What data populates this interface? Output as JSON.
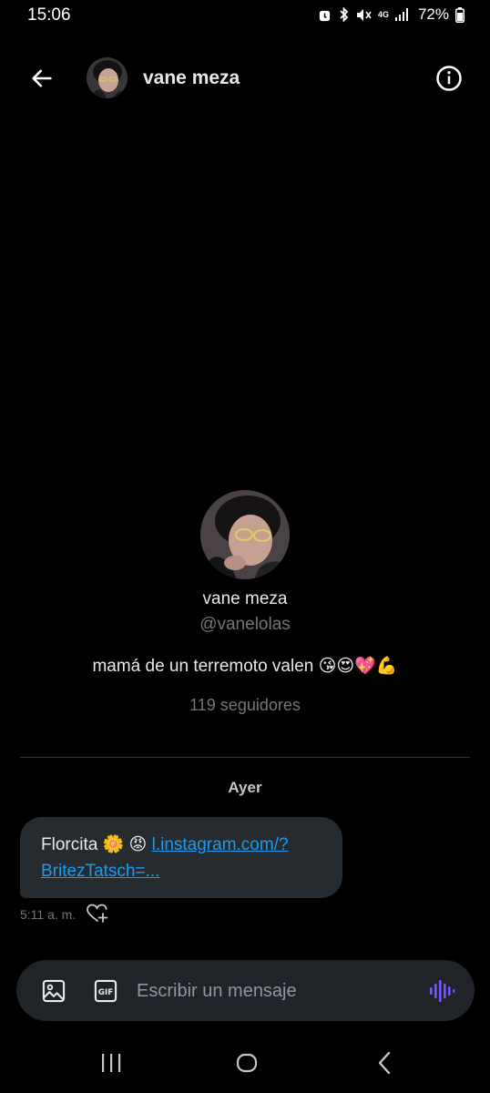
{
  "status_bar": {
    "time": "15:06",
    "battery_percent": "72%",
    "network_label": "4G",
    "icons": [
      "alarm-icon",
      "bluetooth-icon",
      "mute-icon",
      "mobile-data-icon",
      "signal-icon",
      "battery-icon"
    ]
  },
  "header": {
    "name": "vane meza",
    "icons": [
      "back-arrow-icon",
      "info-icon"
    ]
  },
  "profile": {
    "name": "vane meza",
    "handle": "@vanelolas",
    "bio": "mamá de un terremoto valen 😘😍💖💪",
    "followers": "119 seguidores"
  },
  "conversation": {
    "date_separator": "Ayer",
    "messages": [
      {
        "text": "Florcita 🌼 😡 ",
        "link_line1": "l.instagram.com/?",
        "link_line2": "BritezTatsch=...",
        "time": "5:11 a. m."
      }
    ]
  },
  "composer": {
    "placeholder": "Escribir un mensaje",
    "icons": [
      "image-icon",
      "gif-icon",
      "voice-message-icon"
    ]
  },
  "colors": {
    "background": "#000000",
    "primary_text": "#e7e9ea",
    "secondary_text": "#71767b",
    "link": "#1d9bf0",
    "bubble": "#262b30",
    "composer": "#202327",
    "voice_accent": "#7856ff"
  }
}
